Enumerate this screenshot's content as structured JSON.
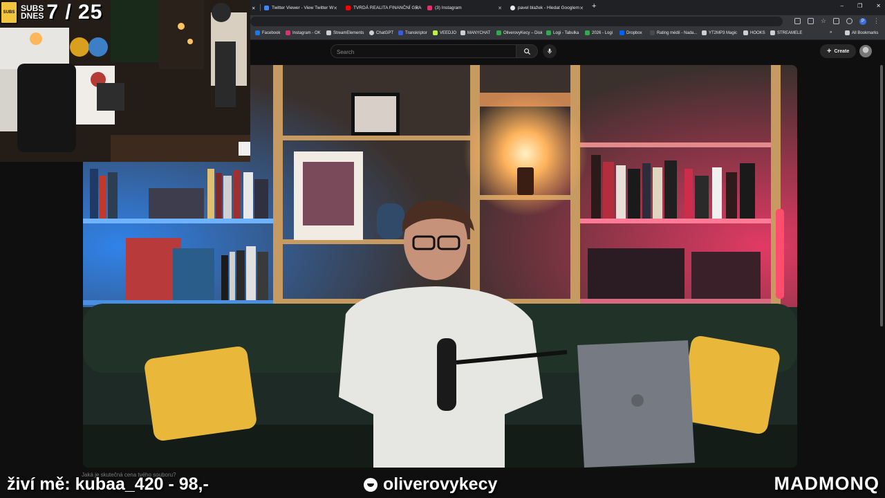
{
  "browser": {
    "tabs": [
      {
        "label": "",
        "favicon_color": "#5f6368"
      },
      {
        "label": "Twitter Viewer - View Twitter W",
        "favicon_color": "#4285f4"
      },
      {
        "label": "TVRDÁ REALITA FINANČNÍ GRA",
        "favicon_color": "#ff0000"
      },
      {
        "label": "(3) Instagram",
        "favicon_color": "#e1306c"
      },
      {
        "label": "pavel blažek - Hledat Googlem",
        "favicon_color": "#4285f4"
      }
    ],
    "bookmarks": [
      {
        "label": "Facebook",
        "color": "#1877f2"
      },
      {
        "label": "Instagram - OK",
        "color": "#e1306c"
      },
      {
        "label": "StreamElements",
        "color": "#cfcfcf"
      },
      {
        "label": "ChatGPT",
        "color": "#cfcfcf"
      },
      {
        "label": "Transkriptor",
        "color": "#3b5bdb"
      },
      {
        "label": "VEEDJO",
        "color": "#b7f34a"
      },
      {
        "label": "MANYCHAT",
        "color": "#cfcfcf"
      },
      {
        "label": "OliverovyKecy – Disk",
        "color": "#34a853"
      },
      {
        "label": "Logi - Tabulka",
        "color": "#34a853"
      },
      {
        "label": "2026 - Logi",
        "color": "#34a853"
      },
      {
        "label": "Dropbox",
        "color": "#0061ff"
      },
      {
        "label": "Rating médií - Nada...",
        "color": "#cfcfcf"
      },
      {
        "label": "YT2MP3 Magic",
        "color": "#cfcfcf"
      },
      {
        "label": "HOOKS",
        "color": "#cfcfcf"
      },
      {
        "label": "STREAMELE",
        "color": "#cfcfcf"
      },
      {
        "label": "All Bookmarks",
        "color": "#cfcfcf"
      }
    ],
    "more_bookmarks": "»",
    "profile_initial": "P"
  },
  "youtube": {
    "search_placeholder": "Search",
    "create_label": "Create",
    "video_caption": "Jaká je skutečná cena tvého souboru?"
  },
  "overlay": {
    "subs_label_1": "SUBS",
    "subs_label_2": "DNES",
    "subs_count": "7 / 25",
    "subs_logo_text": "SUBS",
    "donor_text": "živí mě: kubaa_420 - 98,-",
    "channel_name": "oliverovykecy",
    "sponsor": "MADMONQ"
  },
  "colors": {
    "accent_pink": "#ff3c6e",
    "accent_blue": "#2f8cff",
    "warm": "#ffb35c"
  }
}
